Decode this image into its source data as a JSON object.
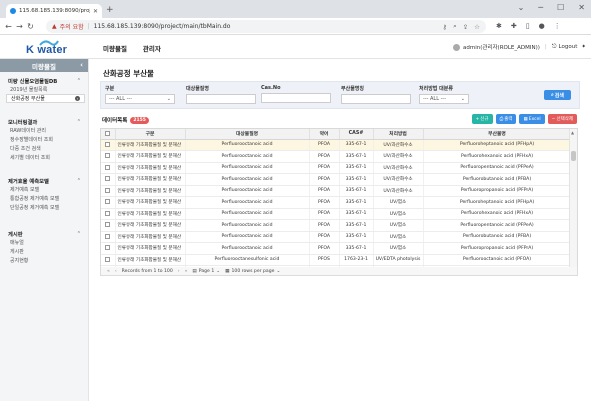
{
  "browser": {
    "tab_title": "115.68.185.139:8090/project/m",
    "url_warning": "주의 요함",
    "url": "115.68.185.139:8090/project/main/tbMain.do"
  },
  "app": {
    "logo_text": "K water",
    "top_menu": [
      "미량물질",
      "관리자"
    ],
    "user": "admin(관리자(ROLE_ADMIN))",
    "logout": "Logout"
  },
  "sidebar": {
    "header": "미량물질",
    "groups": [
      {
        "title": "미량 신물오염물질DB",
        "items": [
          "2019년 물질목록",
          "산화공정 부산물"
        ]
      },
      {
        "title": "모니터링결과",
        "items": [
          "RAW데이터 관리",
          "정수장별데이터 조회",
          "다중 조건 검색",
          "세기별 데이터 조회"
        ]
      },
      {
        "title": "제거효율 예측모델",
        "items": [
          "제거예측 모델",
          "통합공정 제거예측 모델",
          "단일공정 제거예측 모델"
        ]
      },
      {
        "title": "게시판",
        "items": [
          "매뉴얼",
          "게시판",
          "공지현황"
        ]
      }
    ]
  },
  "page": {
    "title": "산화공정 부산물",
    "search": {
      "fields": [
        {
          "label": "구분",
          "value": "--- ALL ---"
        },
        {
          "label": "대상물질명",
          "value": ""
        },
        {
          "label": "Cas.No",
          "value": ""
        },
        {
          "label": "부산물명칭",
          "value": ""
        },
        {
          "label": "처리방법 대분류",
          "value": "--- ALL ---"
        }
      ],
      "button": "검색"
    },
    "list_title": "데이터목록",
    "count": "2155",
    "actions": {
      "add": "신규",
      "print": "출력",
      "excel": "Excel",
      "delete": "선택삭제"
    },
    "columns": [
      "구분",
      "대상물질명",
      "약어",
      "CAS#",
      "처리방법",
      "부산물명"
    ],
    "rows": [
      [
        "인류유래 기초화합물질 및 분해산",
        "Perfluorooctanoic acid",
        "PFOA",
        "335-67-1",
        "UV/과산화수소",
        "Perfluoroheptanoic acid (PFHpA)"
      ],
      [
        "인류유래 기초화합물질 및 분해산",
        "Perfluorooctanoic acid",
        "PFOA",
        "335-67-1",
        "UV/과산화수소",
        "Perfluorohexanoic acid (PFHxA)"
      ],
      [
        "인류유래 기초화합물질 및 분해산",
        "Perfluorooctanoic acid",
        "PFOA",
        "335-67-1",
        "UV/과산화수소",
        "Perfluoropentanoic acid (PFPeA)"
      ],
      [
        "인류유래 기초화합물질 및 분해산",
        "Perfluorooctanoic acid",
        "PFOA",
        "335-67-1",
        "UV/과산화수소",
        "Perfluorobutanoic acid (PFBA)"
      ],
      [
        "인류유래 기초화합물질 및 분해산",
        "Perfluorooctanoic acid",
        "PFOA",
        "335-67-1",
        "UV/과산화수소",
        "Perfluoropropanoic acid (PFPrA)"
      ],
      [
        "인류유래 기초화합물질 및 분해산",
        "Perfluorooctanoic acid",
        "PFOA",
        "335-67-1",
        "UV/염소",
        "Perfluoroheptanoic acid (PFHpA)"
      ],
      [
        "인류유래 기초화합물질 및 분해산",
        "Perfluorooctanoic acid",
        "PFOA",
        "335-67-1",
        "UV/염소",
        "Perfluorohexanoic acid (PFHxA)"
      ],
      [
        "인류유래 기초화합물질 및 분해산",
        "Perfluorooctanoic acid",
        "PFOA",
        "335-67-1",
        "UV/염소",
        "Perfluoropentanoic acid (PFPeA)"
      ],
      [
        "인류유래 기초화합물질 및 분해산",
        "Perfluorooctanoic acid",
        "PFOA",
        "335-67-1",
        "UV/염소",
        "Perfluorobutanoic acid (PFBA)"
      ],
      [
        "인류유래 기초화합물질 및 분해산",
        "Perfluorooctanoic acid",
        "PFOA",
        "335-67-1",
        "UV/염소",
        "Perfluoropropanoic acid (PFPrA)"
      ],
      [
        "인류유래 기초화합물질 및 분해산",
        "Perfluorooctanesulfonic acid",
        "PFOS",
        "1763-23-1",
        "UV/EDTA photolysis",
        "Perfluorooctanoic acid (PFOA)"
      ],
      [
        "인류유래 기초화합물질 및 분해산",
        "Perfluorooctanesulfonic acid",
        "PFOS",
        "1763-23-1",
        "UV/EDTA photolysis",
        "Perfluoroheptanoic acid (PFHpA)"
      ],
      [
        "인류유래 기초화합물질 및 분해산",
        "Perfluorooctanesulfonic acid",
        "PFOS",
        "1763-23-1",
        "UV/EDTA photolysis",
        "Perfluorohexanoic acid (PFHxA)"
      ]
    ],
    "pager": {
      "records": "Records from 1 to 100",
      "page": "Page 1",
      "rows_per_page": "100 rows per page"
    }
  }
}
